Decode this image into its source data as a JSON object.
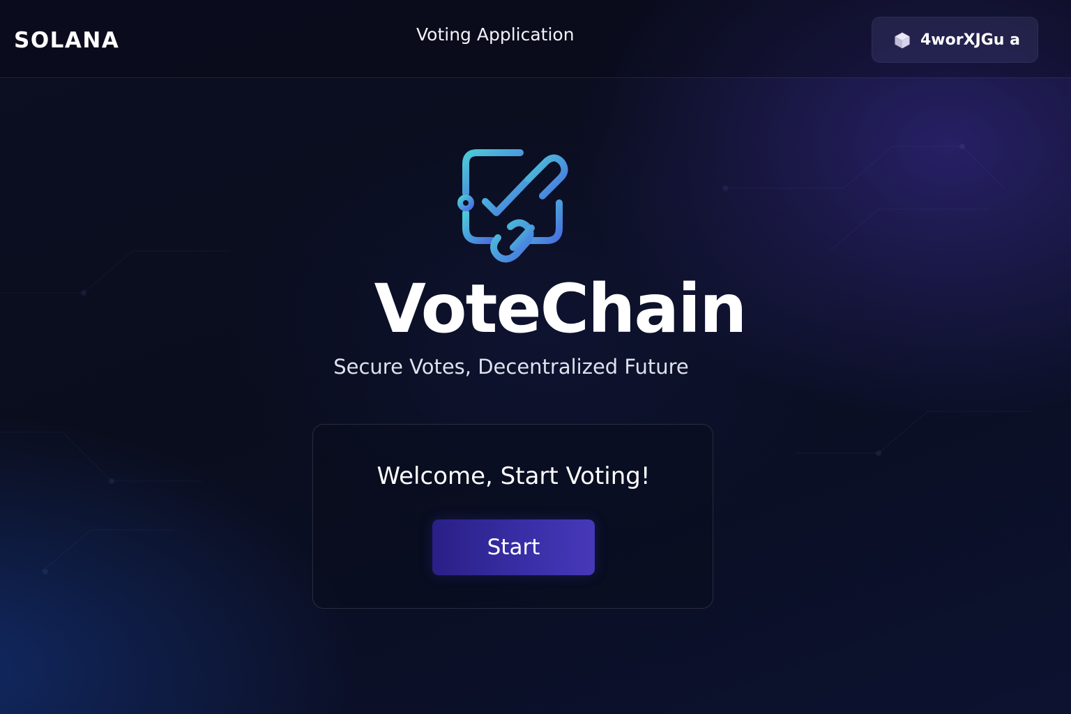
{
  "header": {
    "brand": "SOLANA",
    "title": "Voting Application",
    "wallet": {
      "address": "4worXJGu a",
      "icon": "cube-icon"
    }
  },
  "hero": {
    "logo_icon": "vote-chain-checkbox-icon",
    "title": "VoteChain",
    "subtitle": "Secure Votes, Decentralized Future"
  },
  "card": {
    "heading": "Welcome, Start Voting!",
    "button_label": "Start"
  },
  "colors": {
    "background": "#0a0d1d",
    "button": "#3a2fa8",
    "logo_gradient_start": "#4cc9d8",
    "logo_gradient_end": "#4a78e0"
  }
}
